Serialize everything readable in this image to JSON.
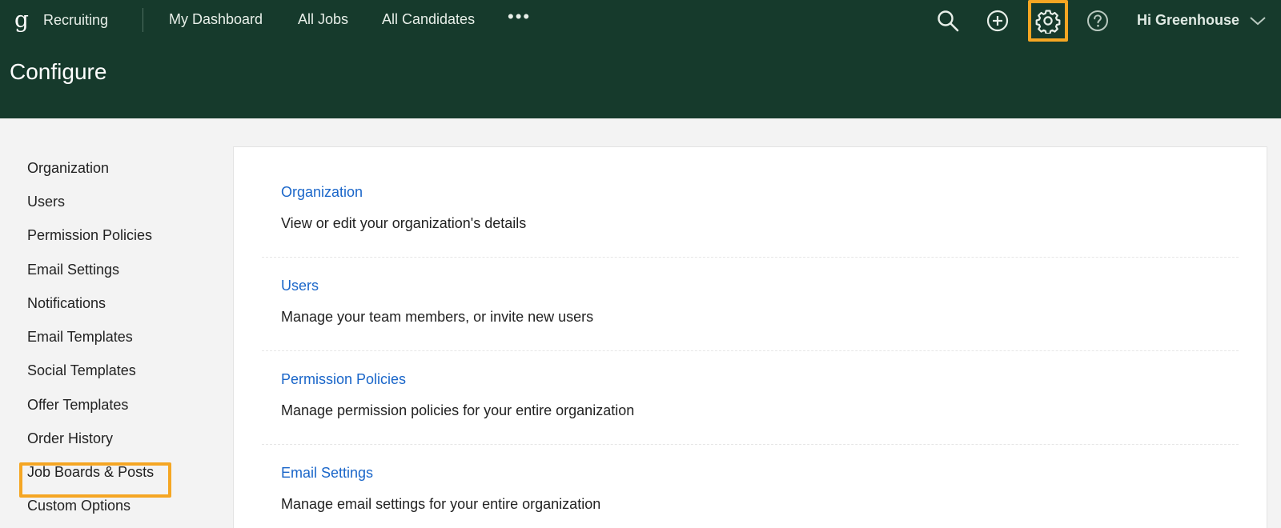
{
  "header": {
    "brand_logo": "g",
    "brand_name": "Recruiting",
    "nav": [
      "My Dashboard",
      "All Jobs",
      "All Candidates"
    ],
    "more_label": "•••",
    "icons": [
      "search-icon",
      "add-circle-icon",
      "gear-icon",
      "help-icon",
      "chevron-down-icon"
    ],
    "user_greeting": "Hi Greenhouse",
    "page_title": "Configure",
    "colors": {
      "header_bg": "#163a2c",
      "highlight": "#f5a623",
      "link": "#1a66c9"
    }
  },
  "sidebar": {
    "items": [
      "Organization",
      "Users",
      "Permission Policies",
      "Email Settings",
      "Notifications",
      "Email Templates",
      "Social Templates",
      "Offer Templates",
      "Order History",
      "Job Boards & Posts",
      "Custom Options"
    ],
    "highlighted_item": "Job Boards & Posts"
  },
  "main": {
    "sections": [
      {
        "title": "Organization",
        "description": "View or edit your organization's details"
      },
      {
        "title": "Users",
        "description": "Manage your team members, or invite new users"
      },
      {
        "title": "Permission Policies",
        "description": "Manage permission policies for your entire organization"
      },
      {
        "title": "Email Settings",
        "description": "Manage email settings for your entire organization"
      }
    ]
  }
}
